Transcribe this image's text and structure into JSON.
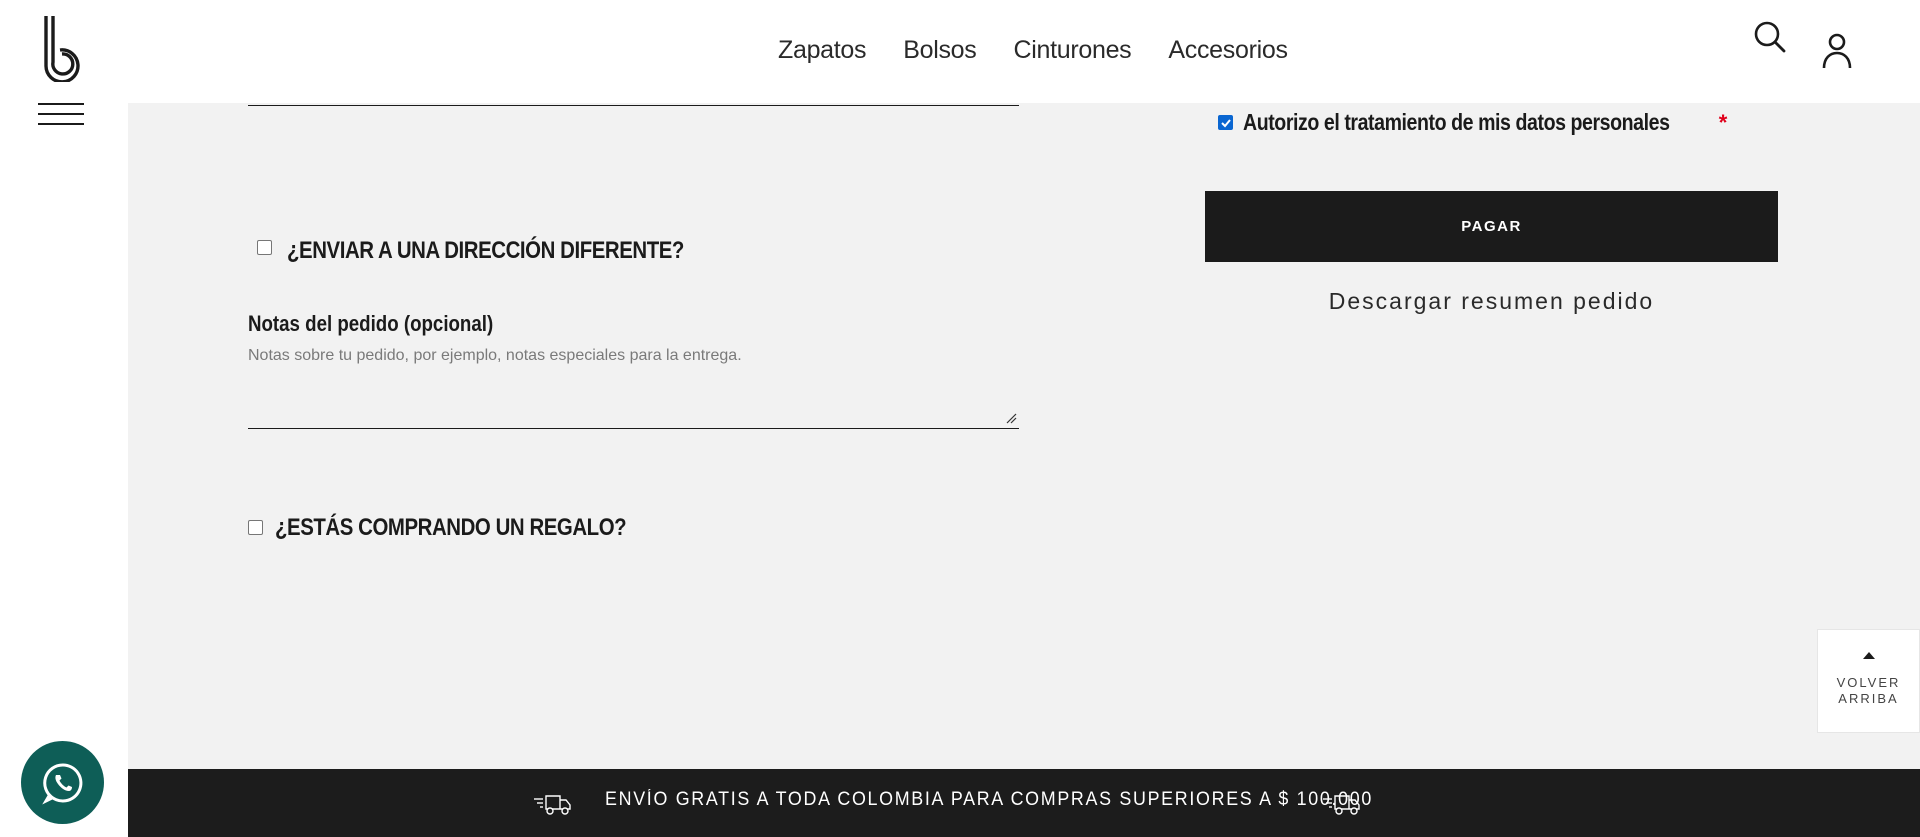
{
  "nav": {
    "items": [
      "Zapatos",
      "Bolsos",
      "Cinturones",
      "Accesorios"
    ]
  },
  "header": {
    "logo_icon": "brand-b-logo",
    "search_icon": "search-icon",
    "user_icon": "user-icon",
    "menu_icon": "hamburger-menu-icon"
  },
  "form": {
    "ship_different_label": "¿ENVIAR A UNA DIRECCIÓN DIFERENTE?",
    "ship_different_checked": false,
    "notes_label": "Notas del pedido (opcional)",
    "notes_placeholder": "Notas sobre tu pedido, por ejemplo, notas especiales para la entrega.",
    "notes_value": "",
    "gift_label": "¿ESTÁS COMPRANDO UN REGALO?",
    "gift_checked": false
  },
  "checkout": {
    "authorize_label": "Autorizo el tratamiento de mis datos personales",
    "authorize_required_mark": "*",
    "authorize_checked": true,
    "pay_button": "PAGAR",
    "download_link": "Descargar resumen pedido"
  },
  "back_to_top": {
    "line1": "VOLVER",
    "line2": "ARRIBA"
  },
  "banner": {
    "text": "ENVÍO GRATIS A TODA COLOMBIA PARA COMPRAS SUPERIORES A $ 100.000",
    "icon": "delivery-truck-icon"
  },
  "colors": {
    "accent_dark": "#1c1c1c",
    "page_bg": "#f2f2f2",
    "whatsapp": "#0e5e57",
    "required": "#e0001b",
    "checkbox": "#0a66d1"
  }
}
